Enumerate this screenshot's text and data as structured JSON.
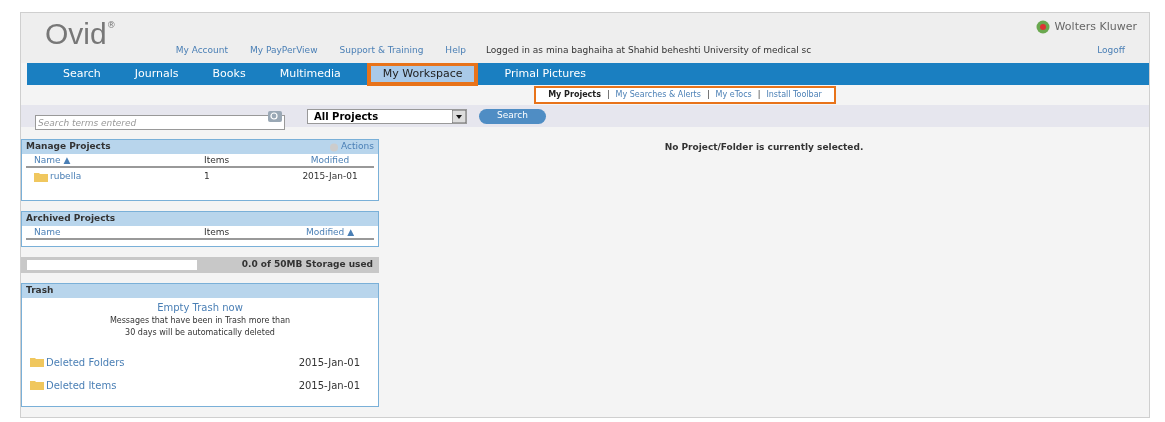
{
  "header": {
    "logo": "Ovid",
    "logo_mark": "®",
    "brand": "Wolters Kluwer",
    "links": [
      "My Account",
      "My PayPerView",
      "Support & Training",
      "Help"
    ],
    "login_text": "Logged in as mina baghaiha at Shahid beheshti University of medical sc",
    "logoff": "Logoff"
  },
  "nav_tabs": [
    {
      "label": "Search",
      "selected": false
    },
    {
      "label": "Journals",
      "selected": false
    },
    {
      "label": "Books",
      "selected": false
    },
    {
      "label": "Multimedia",
      "selected": false
    },
    {
      "label": "My Workspace",
      "selected": true
    },
    {
      "label": "Primal Pictures",
      "selected": false
    }
  ],
  "sub_separator": "|",
  "sub_tabs": [
    {
      "label": "My Projects",
      "selected": true
    },
    {
      "label": "My Searches & Alerts",
      "selected": false
    },
    {
      "label": "My eTocs",
      "selected": false
    },
    {
      "label": "Install Toolbar",
      "selected": false
    }
  ],
  "search": {
    "placeholder": "Search terms entered",
    "scope": "All Projects",
    "button": "Search"
  },
  "manage_projects": {
    "title": "Manage Projects",
    "actions": "Actions",
    "columns": [
      "Name ▲",
      "Items",
      "Modified"
    ],
    "rows": [
      {
        "name": "rubella",
        "items": "1",
        "modified": "2015-Jan-01"
      }
    ]
  },
  "archived_projects": {
    "title": "Archived Projects",
    "columns": [
      "Name",
      "Items",
      "Modified ▲"
    ]
  },
  "storage": {
    "level": 0,
    "label": "0.0 of 50MB Storage used"
  },
  "trash": {
    "title": "Trash",
    "empty_link": "Empty Trash now",
    "note_lines": [
      "Messages that have been in Trash more than",
      "30 days will be automatically deleted"
    ],
    "rows": [
      {
        "name": "Deleted Folders",
        "date": "2015-Jan-01"
      },
      {
        "name": "Deleted Items",
        "date": "2015-Jan-01"
      }
    ]
  },
  "message": "No Project/Folder is currently selected."
}
